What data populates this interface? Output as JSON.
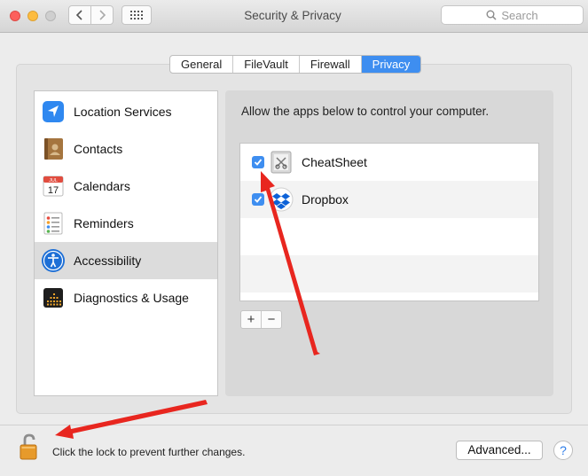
{
  "window": {
    "title": "Security & Privacy"
  },
  "toolbar": {
    "search_placeholder": "Search"
  },
  "tabs": [
    {
      "label": "General",
      "active": false
    },
    {
      "label": "FileVault",
      "active": false
    },
    {
      "label": "Firewall",
      "active": false
    },
    {
      "label": "Privacy",
      "active": true
    }
  ],
  "sidebar": {
    "items": [
      {
        "label": "Location Services",
        "icon": "location-arrow-icon",
        "selected": false
      },
      {
        "label": "Contacts",
        "icon": "contacts-book-icon",
        "selected": false
      },
      {
        "label": "Calendars",
        "icon": "calendar-icon",
        "selected": false,
        "icon_month": "JUL",
        "icon_day": "17"
      },
      {
        "label": "Reminders",
        "icon": "reminders-list-icon",
        "selected": false
      },
      {
        "label": "Accessibility",
        "icon": "accessibility-person-icon",
        "selected": true
      },
      {
        "label": "Diagnostics & Usage",
        "icon": "diagnostics-grid-icon",
        "selected": false
      }
    ]
  },
  "main": {
    "prompt": "Allow the apps below to control your computer.",
    "apps": [
      {
        "label": "CheatSheet",
        "checked": true,
        "icon": "cheatsheet-app-icon"
      },
      {
        "label": "Dropbox",
        "checked": true,
        "icon": "dropbox-app-icon"
      }
    ],
    "add_label": "+",
    "remove_label": "−"
  },
  "footer": {
    "lock_text": "Click the lock to prevent further changes.",
    "advanced_label": "Advanced...",
    "help_label": "?"
  },
  "colors": {
    "accent": "#3e8ef0",
    "annotation_arrow": "#e8261f"
  }
}
